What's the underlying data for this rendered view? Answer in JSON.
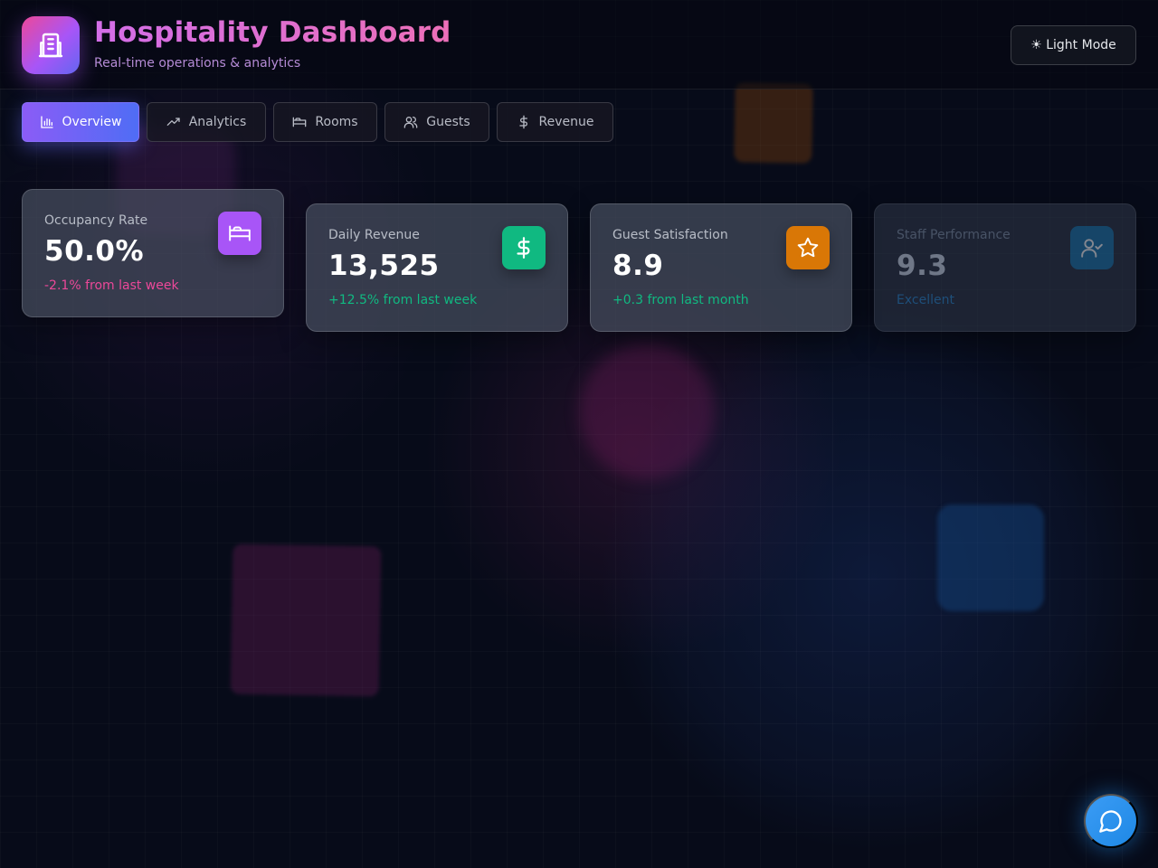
{
  "header": {
    "title": "Hospitality Dashboard",
    "subtitle": "Real-time operations & analytics",
    "theme_toggle_label": "☀ Light Mode",
    "logo_icon": "building-icon"
  },
  "tabs": [
    {
      "label": "Overview",
      "icon": "bar-chart-icon",
      "active": true
    },
    {
      "label": "Analytics",
      "icon": "trending-up-icon",
      "active": false
    },
    {
      "label": "Rooms",
      "icon": "bed-icon",
      "active": false
    },
    {
      "label": "Guests",
      "icon": "users-icon",
      "active": false
    },
    {
      "label": "Revenue",
      "icon": "dollar-icon",
      "active": false
    }
  ],
  "cards": [
    {
      "label": "Occupancy Rate",
      "value": "50.0%",
      "change": "-2.1% from last week",
      "change_color": "#ec4899",
      "icon": "bed-icon",
      "icon_color": "#a855f7"
    },
    {
      "label": "Daily Revenue",
      "value": "13,525",
      "change": "+12.5% from last week",
      "change_color": "#10b981",
      "icon": "dollar-icon",
      "icon_color": "#10b981"
    },
    {
      "label": "Guest Satisfaction",
      "value": "8.9",
      "change": "+0.3 from last month",
      "change_color": "#10b981",
      "icon": "star-icon",
      "icon_color": "#d97706"
    },
    {
      "label": "Staff Performance",
      "value": "9.3",
      "change": "Excellent",
      "change_color": "#1e4f7a",
      "icon": "user-check-icon",
      "icon_color": "#0e6fa8"
    }
  ],
  "chat_button": {
    "icon": "chat-bubble-icon"
  }
}
